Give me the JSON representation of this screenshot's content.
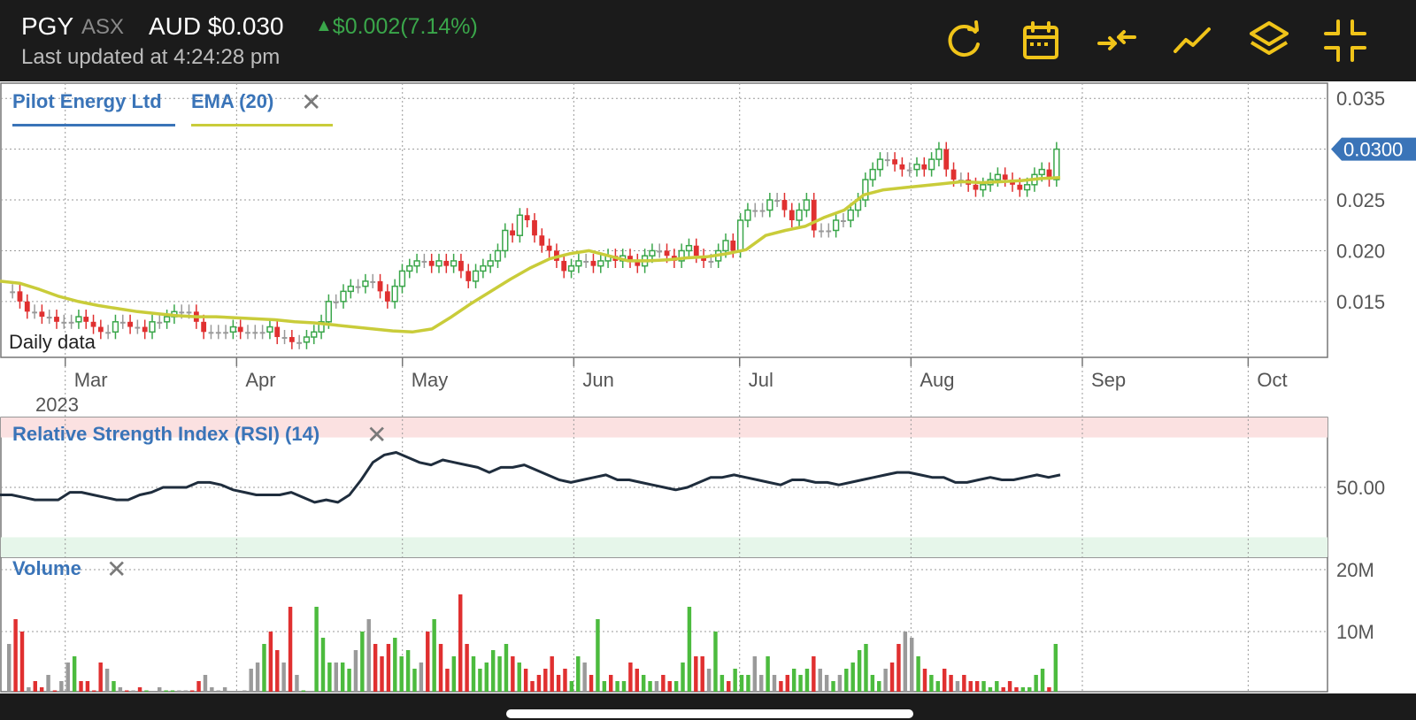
{
  "header": {
    "ticker": "PGY",
    "exchange": "ASX",
    "price": "AUD $0.030",
    "change_arrow": "▲",
    "change": "$0.002",
    "change_pct": "(7.14%)",
    "last_updated": "Last updated at 4:24:28 pm",
    "accent_color": "#f0c419",
    "up_color": "#3aa64a"
  },
  "toolbar": [
    "refresh-icon",
    "calendar-icon",
    "compare-icon",
    "line-chart-icon",
    "layers-icon",
    "collapse-icon"
  ],
  "chart_data": [
    {
      "type": "candlestick",
      "title": "",
      "series": [
        {
          "name": "Pilot Energy Ltd"
        },
        {
          "name": "EMA (20)"
        }
      ],
      "x_tick_labels": [
        "Mar",
        "Apr",
        "May",
        "Jun",
        "Jul",
        "Aug",
        "Sep",
        "Oct"
      ],
      "x_year_label": "2023",
      "x_tick_dates": [
        "2023-03-01",
        "2023-04-01",
        "2023-05-01",
        "2023-06-01",
        "2023-07-01",
        "2023-08-01",
        "2023-09-01",
        "2023-10-01"
      ],
      "y_tick_labels": [
        "0.035",
        "0.025",
        "0.020",
        "0.015"
      ],
      "y_ticks": [
        0.035,
        0.03,
        0.025,
        0.02,
        0.015
      ],
      "ylim": [
        0.0095,
        0.0365
      ],
      "last_price_label": "0.0300",
      "last_price": 0.03,
      "annotation": "Daily data",
      "grid": true,
      "close_approx": [
        0.016,
        0.015,
        0.014,
        0.014,
        0.0135,
        0.0135,
        0.013,
        0.013,
        0.013,
        0.0135,
        0.013,
        0.0125,
        0.012,
        0.012,
        0.013,
        0.013,
        0.0125,
        0.0125,
        0.012,
        0.013,
        0.013,
        0.0135,
        0.014,
        0.014,
        0.014,
        0.013,
        0.012,
        0.012,
        0.012,
        0.012,
        0.0125,
        0.012,
        0.012,
        0.012,
        0.012,
        0.0125,
        0.0115,
        0.0115,
        0.011,
        0.011,
        0.0115,
        0.012,
        0.013,
        0.015,
        0.015,
        0.016,
        0.0165,
        0.0165,
        0.017,
        0.017,
        0.016,
        0.015,
        0.0165,
        0.018,
        0.0185,
        0.019,
        0.019,
        0.0185,
        0.019,
        0.0185,
        0.019,
        0.018,
        0.017,
        0.018,
        0.0185,
        0.019,
        0.02,
        0.022,
        0.0215,
        0.0235,
        0.023,
        0.0215,
        0.0205,
        0.02,
        0.019,
        0.018,
        0.0185,
        0.019,
        0.019,
        0.0185,
        0.019,
        0.0195,
        0.019,
        0.0195,
        0.019,
        0.0185,
        0.0195,
        0.02,
        0.02,
        0.0195,
        0.019,
        0.02,
        0.0205,
        0.0195,
        0.019,
        0.019,
        0.02,
        0.021,
        0.02,
        0.023,
        0.024,
        0.024,
        0.024,
        0.025,
        0.025,
        0.024,
        0.023,
        0.024,
        0.025,
        0.022,
        0.022,
        0.022,
        0.023,
        0.023,
        0.024,
        0.025,
        0.027,
        0.028,
        0.029,
        0.029,
        0.0285,
        0.028,
        0.028,
        0.0285,
        0.028,
        0.029,
        0.03,
        0.028,
        0.027,
        0.027,
        0.0265,
        0.026,
        0.0265,
        0.027,
        0.0275,
        0.027,
        0.0265,
        0.026,
        0.0265,
        0.0275,
        0.028,
        0.027,
        0.03
      ],
      "ema_approx": [
        0.017,
        0.0168,
        0.0162,
        0.0155,
        0.015,
        0.0146,
        0.0143,
        0.014,
        0.0138,
        0.0136,
        0.0135,
        0.0135,
        0.0134,
        0.0133,
        0.0132,
        0.013,
        0.0129,
        0.0127,
        0.0125,
        0.0123,
        0.0121,
        0.012,
        0.0123,
        0.0135,
        0.0148,
        0.016,
        0.0172,
        0.0183,
        0.0192,
        0.0197,
        0.02,
        0.0195,
        0.019,
        0.019,
        0.0191,
        0.0193,
        0.0194,
        0.0197,
        0.0201,
        0.0215,
        0.022,
        0.0224,
        0.0233,
        0.024,
        0.0255,
        0.026,
        0.0262,
        0.0264,
        0.0266,
        0.0268,
        0.0267,
        0.0268,
        0.0269,
        0.0271,
        0.0272
      ],
      "candle_colors": {
        "up": "#3aa64a",
        "down": "#e03030",
        "flat": "#9a9a9a"
      },
      "ema_color": "#c9cc3a"
    },
    {
      "type": "line",
      "series": [
        {
          "name": "Relative Strength Index (RSI) (14)"
        }
      ],
      "y_tick_labels": [
        "50.00"
      ],
      "y_ticks": [
        50
      ],
      "overbought": 70,
      "oversold": 30,
      "ylim": [
        22,
        78
      ],
      "values_approx": [
        47,
        47,
        46,
        45,
        45,
        45,
        48,
        48,
        47,
        46,
        45,
        45,
        47,
        48,
        50,
        50,
        50,
        52,
        52,
        51,
        49,
        48,
        47,
        47,
        47,
        48,
        46,
        44,
        45,
        44,
        47,
        53,
        60,
        63,
        64,
        62,
        60,
        59,
        61,
        60,
        59,
        58,
        56,
        58,
        58,
        59,
        57,
        55,
        53,
        52,
        53,
        54,
        55,
        53,
        53,
        52,
        51,
        50,
        49,
        50,
        52,
        54,
        54,
        55,
        54,
        53,
        52,
        51,
        53,
        53,
        52,
        52,
        51,
        52,
        53,
        54,
        55,
        56,
        56,
        55,
        54,
        54,
        52,
        52,
        53,
        54,
        53,
        53,
        54,
        55,
        54,
        55
      ],
      "line_color": "#1f2d3d"
    },
    {
      "type": "bar",
      "series": [
        {
          "name": "Volume"
        }
      ],
      "y_tick_labels": [
        "20M",
        "10M"
      ],
      "y_ticks": [
        20,
        10
      ],
      "ylim": [
        0,
        22
      ],
      "unit": "M",
      "values_approx": [
        8,
        12,
        10,
        1,
        2,
        1,
        3,
        0.5,
        2,
        5,
        6,
        2,
        2,
        0.5,
        5,
        4,
        2,
        1,
        0.5,
        0.5,
        1,
        0.5,
        0.3,
        1,
        0.5,
        0.5,
        0.5,
        0.5,
        0.5,
        2,
        3,
        1,
        0.5,
        1,
        0.2,
        0.2,
        0.5,
        4,
        5,
        8,
        10,
        7,
        5,
        14,
        3,
        0.5,
        0.2,
        14,
        9,
        5,
        5,
        5,
        4,
        7,
        10,
        12,
        8,
        6,
        8,
        9,
        6,
        7,
        4,
        5,
        10,
        12,
        8,
        4,
        6,
        16,
        8,
        6,
        4,
        5,
        7,
        6,
        8,
        6,
        5,
        4,
        2,
        3,
        4,
        6,
        3,
        4,
        2,
        6,
        5,
        3,
        12,
        2,
        3,
        2,
        2,
        5,
        4,
        3,
        2,
        2,
        3,
        2,
        2,
        5,
        14,
        6,
        6,
        4,
        10,
        3,
        2,
        4,
        3,
        3,
        6,
        3,
        6,
        3,
        2,
        3,
        4,
        3,
        4,
        6,
        4,
        3,
        2,
        3,
        4,
        5,
        7,
        8,
        3,
        2,
        4,
        5,
        8,
        10,
        9,
        6,
        4,
        3,
        2,
        4,
        3,
        2,
        3,
        2,
        2,
        2,
        1,
        2,
        1,
        2,
        1,
        1,
        1,
        3,
        4,
        1,
        8
      ],
      "colors": {
        "up": "#4cbb3e",
        "down": "#e03030",
        "flat": "#9a9a9a"
      }
    }
  ],
  "price_legend": {
    "name": "Pilot Energy Ltd",
    "ema": "EMA (20)"
  },
  "rsi_legend": "Relative Strength Index (RSI) (14)",
  "volume_legend": "Volume",
  "close_glyph": "✕"
}
